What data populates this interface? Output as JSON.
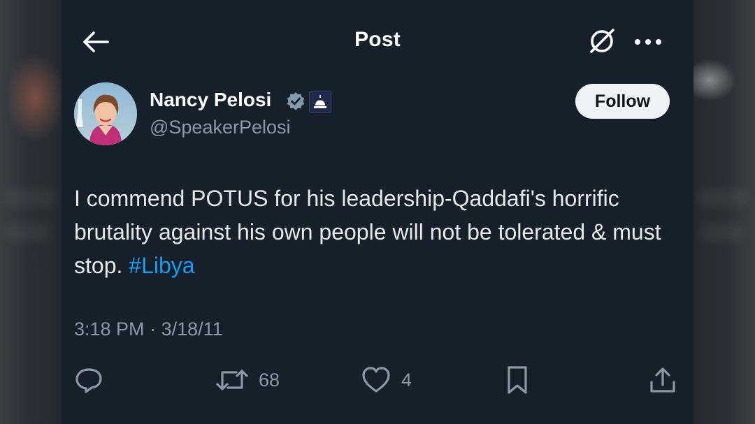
{
  "header": {
    "title": "Post",
    "back_icon": "arrow-left-icon",
    "grok_icon": "grok-icon",
    "more_icon": "more-dots-icon"
  },
  "author": {
    "name": "Nancy Pelosi",
    "handle": "@SpeakerPelosi",
    "verified_icon": "verified-badge-icon",
    "affiliation_icon": "us-capitol-icon",
    "follow_label": "Follow"
  },
  "tweet": {
    "text": "I commend POTUS for his leadership-Qaddafi's horrific brutality against his own people will not be tolerated & must stop. ",
    "hashtag": "#Libya",
    "time": "3:18 PM",
    "separator": "·",
    "date": "3/18/11"
  },
  "actions": {
    "reply_icon": "reply-icon",
    "retweet_icon": "retweet-icon",
    "retweets": "68",
    "like_icon": "heart-icon",
    "likes": "4",
    "bookmark_icon": "bookmark-icon",
    "share_icon": "share-icon"
  },
  "colors": {
    "background": "#15202b",
    "text": "#e7e9ea",
    "secondary_text": "#8b98a5",
    "link": "#1d9bf0",
    "verified": "#829aab",
    "follow_bg": "#eff3f4"
  }
}
